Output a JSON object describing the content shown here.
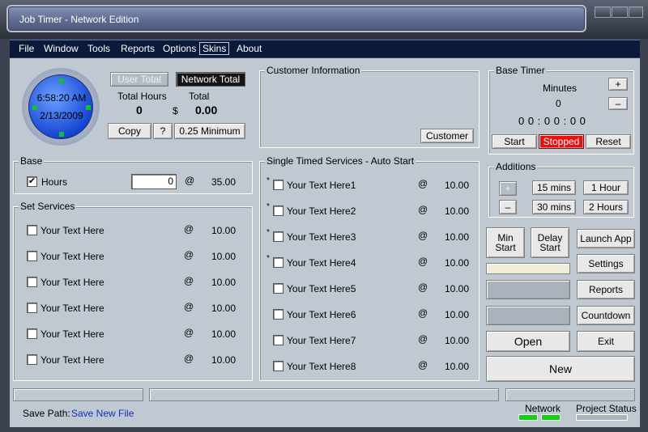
{
  "window": {
    "title": "Job Timer - Network Edition"
  },
  "menu": [
    "File",
    "Window",
    "Tools",
    "Reports",
    "Options",
    "Skins",
    "About"
  ],
  "clock": {
    "time": "6:58:20 AM",
    "date": "2/13/2009"
  },
  "totals": {
    "user_total_btn": "User Total",
    "network_total_btn": "Network Total",
    "hours_label": "Total Hours",
    "total_label": "Total",
    "hours_value": "0",
    "currency": "$",
    "total_value": "0.00",
    "copy_btn": "Copy",
    "help_btn": "?",
    "minimum_btn": "0.25 Minimum"
  },
  "customer": {
    "title": "Customer Information",
    "button": "Customer"
  },
  "base_timer": {
    "title": "Base Timer",
    "minutes_label": "Minutes",
    "minutes_value": "0",
    "plus": "+",
    "minus": "–",
    "display": "0 0 : 0 0 : 0 0",
    "start": "Start",
    "status": "Stopped",
    "reset": "Reset"
  },
  "additions": {
    "title": "Additions",
    "plus": "+",
    "minus": "–",
    "b15": "15 mins",
    "b1h": "1 Hour",
    "b30": "30 mins",
    "b2h": "2 Hours"
  },
  "base": {
    "title": "Base",
    "hours_label": "Hours",
    "hours_value": "0",
    "at": "@",
    "rate": "35.00",
    "checked": "✔"
  },
  "set_services": {
    "title": "Set Services",
    "items": [
      {
        "label": "Your Text Here",
        "at": "@",
        "rate": "10.00"
      },
      {
        "label": "Your Text Here",
        "at": "@",
        "rate": "10.00"
      },
      {
        "label": "Your Text Here",
        "at": "@",
        "rate": "10.00"
      },
      {
        "label": "Your Text Here",
        "at": "@",
        "rate": "10.00"
      },
      {
        "label": "Your Text Here",
        "at": "@",
        "rate": "10.00"
      },
      {
        "label": "Your Text Here",
        "at": "@",
        "rate": "10.00"
      }
    ]
  },
  "timed_services": {
    "title": "Single Timed Services - Auto Start",
    "items": [
      {
        "star": "*",
        "label": "Your Text Here1",
        "at": "@",
        "rate": "10.00"
      },
      {
        "star": "*",
        "label": "Your Text Here2",
        "at": "@",
        "rate": "10.00"
      },
      {
        "star": "*",
        "label": "Your Text Here3",
        "at": "@",
        "rate": "10.00"
      },
      {
        "star": "*",
        "label": "Your Text Here4",
        "at": "@",
        "rate": "10.00"
      },
      {
        "star": "",
        "label": "Your Text Here5",
        "at": "@",
        "rate": "10.00"
      },
      {
        "star": "",
        "label": "Your Text Here6",
        "at": "@",
        "rate": "10.00"
      },
      {
        "star": "",
        "label": "Your Text Here7",
        "at": "@",
        "rate": "10.00"
      },
      {
        "star": "",
        "label": "Your Text Here8",
        "at": "@",
        "rate": "10.00"
      }
    ]
  },
  "actions": {
    "min_start": "Min\nStart",
    "delay_start": "Delay\nStart",
    "launch_app": "Launch App",
    "settings": "Settings",
    "reports": "Reports",
    "countdown": "Countdown",
    "open": "Open",
    "exit": "Exit",
    "new": "New"
  },
  "status": {
    "save_path_label": "Save Path:",
    "save_path_link": "Save New File",
    "network_label": "Network",
    "project_status_label": "Project Status"
  },
  "colors": {
    "menu_bg": "#0a1a3a",
    "panel_bg": "#c0c8d2",
    "stopped_red": "#e81010",
    "led_green": "#12d012",
    "link_blue": "#1030c0"
  }
}
